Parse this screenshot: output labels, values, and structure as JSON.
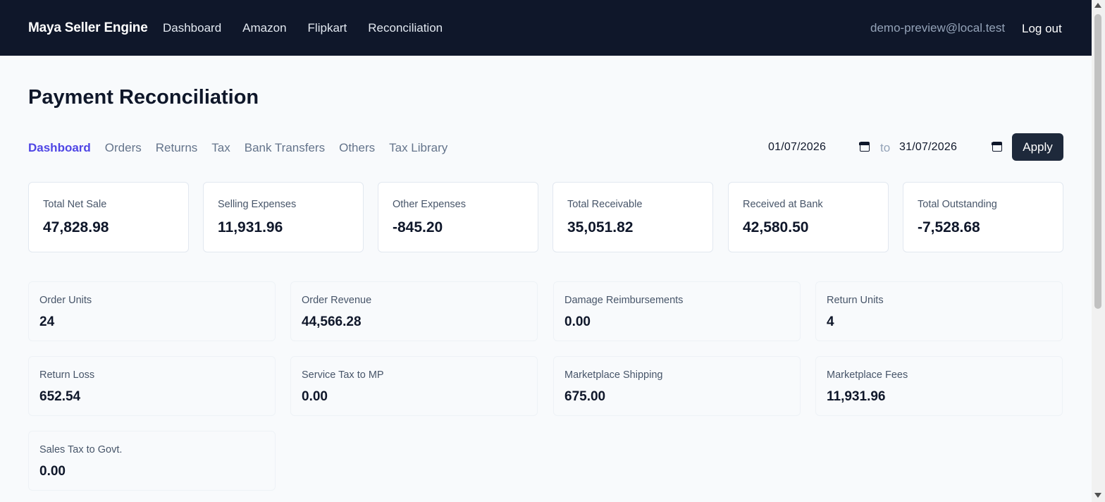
{
  "app": {
    "brand": "Maya Seller Engine",
    "nav": [
      "Dashboard",
      "Amazon",
      "Flipkart",
      "Reconciliation"
    ],
    "user_email": "demo-preview@local.test",
    "logout_label": "Log out"
  },
  "page": {
    "title": "Payment Reconciliation"
  },
  "tabs": {
    "items": [
      "Dashboard",
      "Orders",
      "Returns",
      "Tax",
      "Bank Transfers",
      "Others",
      "Tax Library"
    ],
    "active": "Dashboard"
  },
  "filter": {
    "from_date": "01/07/2026",
    "separator": "to",
    "to_date": "31/07/2026",
    "apply_label": "Apply"
  },
  "summary": [
    {
      "label": "Total Net Sale",
      "value": "47,828.98"
    },
    {
      "label": "Selling Expenses",
      "value": "11,931.96"
    },
    {
      "label": "Other Expenses",
      "value": "-845.20"
    },
    {
      "label": "Total Receivable",
      "value": "35,051.82"
    },
    {
      "label": "Received at Bank",
      "value": "42,580.50"
    },
    {
      "label": "Total Outstanding",
      "value": "-7,528.68"
    }
  ],
  "metrics": [
    {
      "label": "Order Units",
      "value": "24"
    },
    {
      "label": "Order Revenue",
      "value": "44,566.28"
    },
    {
      "label": "Damage Reimbursements",
      "value": "0.00"
    },
    {
      "label": "Return Units",
      "value": "4"
    },
    {
      "label": "Return Loss",
      "value": "652.54"
    },
    {
      "label": "Service Tax to MP",
      "value": "0.00"
    },
    {
      "label": "Marketplace Shipping",
      "value": "675.00"
    },
    {
      "label": "Marketplace Fees",
      "value": "11,931.96"
    },
    {
      "label": "Sales Tax to Govt.",
      "value": "0.00"
    }
  ],
  "colors": {
    "header_bg": "#0f172a",
    "active_tab": "#4f46e5",
    "button_bg": "#1e293b",
    "page_bg": "#f8fafc"
  }
}
